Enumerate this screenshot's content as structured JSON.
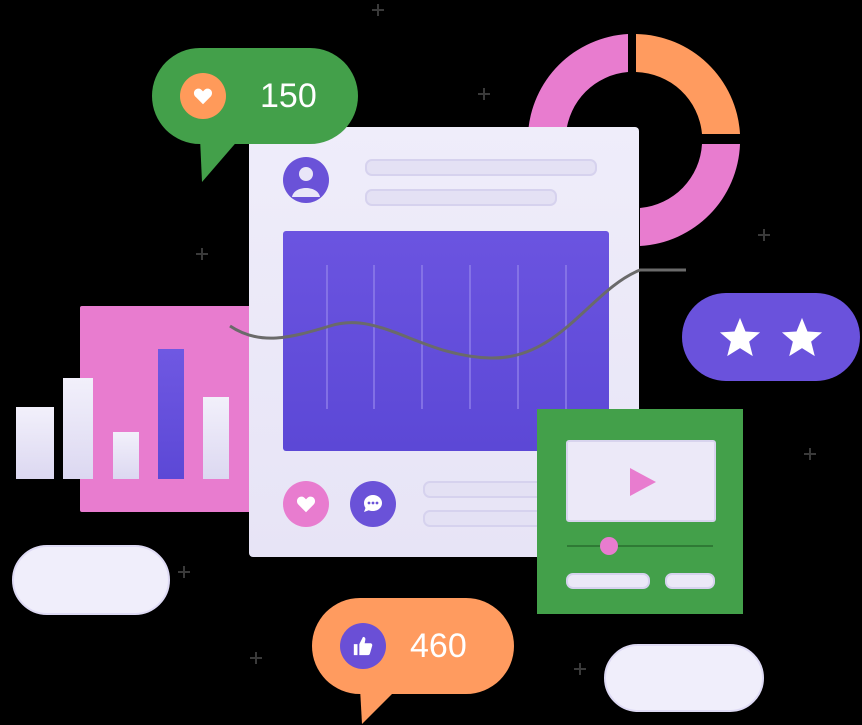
{
  "likes_bubble": {
    "count": "150",
    "icon": "heart-icon",
    "color": "#43a04a",
    "icon_bg": "#ff9a5a"
  },
  "thumbs_bubble": {
    "count": "460",
    "icon": "thumbs-up-icon",
    "color": "#ff9b5f",
    "icon_bg": "#6a4fd6"
  },
  "rating_pill": {
    "stars": 2,
    "icon": "star-icon",
    "color": "#6a52dc"
  },
  "post_card": {
    "avatar_icon": "user-icon",
    "actions": [
      "heart-icon",
      "comment-icon"
    ],
    "accent": "#6a52d8"
  },
  "donut": {
    "colors": [
      "#ff9b5f",
      "#e87ccf"
    ]
  },
  "video_card": {
    "icon": "play-icon",
    "slider_fraction": 0.3,
    "color": "#43a04a"
  },
  "bar_panel": {
    "color": "#e87ccf",
    "highlight": "#6a52dc"
  }
}
